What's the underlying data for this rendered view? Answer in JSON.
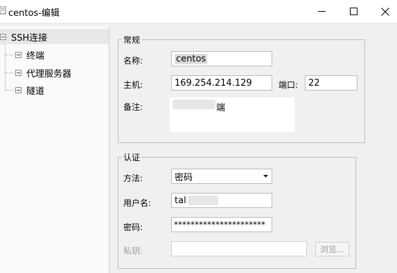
{
  "window": {
    "title": "centos-编辑",
    "controls": [
      "minimize-icon",
      "maximize-icon",
      "close-icon"
    ]
  },
  "tree": {
    "root": {
      "label": "SSH连接",
      "selected": true
    },
    "children": [
      {
        "label": "终端"
      },
      {
        "label": "代理服务器"
      },
      {
        "label": "隧道"
      }
    ]
  },
  "general": {
    "legend": "常规",
    "name_label": "名称:",
    "name_value": "centos",
    "host_label": "主机:",
    "host_value": "169.254.214.129",
    "port_label": "端口:",
    "port_value": "22",
    "note_label": "备注:",
    "note_value": "端"
  },
  "auth": {
    "legend": "认证",
    "method_label": "方法:",
    "method_value": "密码",
    "username_label": "用户名:",
    "username_value": "tal",
    "password_label": "密码:",
    "password_value": "**********************",
    "key_label": "私钥:",
    "key_value": "",
    "browse_label": "浏览..."
  },
  "colors": {
    "background": "#f0f0f0",
    "disabled_text": "#9e9e9e",
    "selected_row": "#e8e8e8"
  }
}
